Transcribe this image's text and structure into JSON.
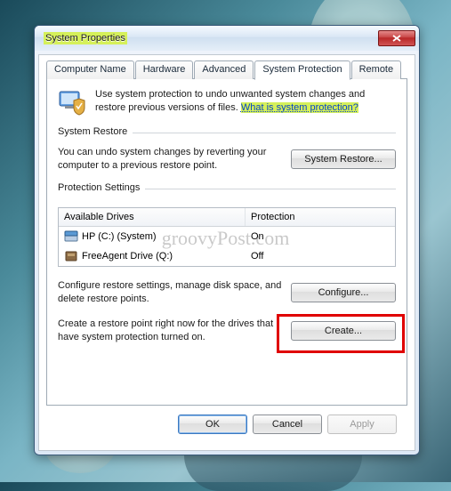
{
  "window": {
    "title": "System Properties"
  },
  "tabs": {
    "computer_name": "Computer Name",
    "hardware": "Hardware",
    "advanced": "Advanced",
    "system_protection": "System Protection",
    "remote": "Remote"
  },
  "info": {
    "text": "Use system protection to undo unwanted system changes and restore previous versions of files. ",
    "link": "What is system protection?"
  },
  "restore": {
    "group_label": "System Restore",
    "text": "You can undo system changes by reverting your computer to a previous restore point.",
    "button": "System Restore..."
  },
  "protection": {
    "group_label": "Protection Settings",
    "col_drive": "Available Drives",
    "col_protection": "Protection",
    "drives": [
      {
        "name": "HP (C:) (System)",
        "protection": "On"
      },
      {
        "name": "FreeAgent Drive (Q:)",
        "protection": "Off"
      }
    ],
    "configure_text": "Configure restore settings, manage disk space, and delete restore points.",
    "configure_button": "Configure...",
    "create_text": "Create a restore point right now for the drives that have system protection turned on.",
    "create_button": "Create..."
  },
  "footer": {
    "ok": "OK",
    "cancel": "Cancel",
    "apply": "Apply"
  },
  "watermark": "groovyPost.com"
}
